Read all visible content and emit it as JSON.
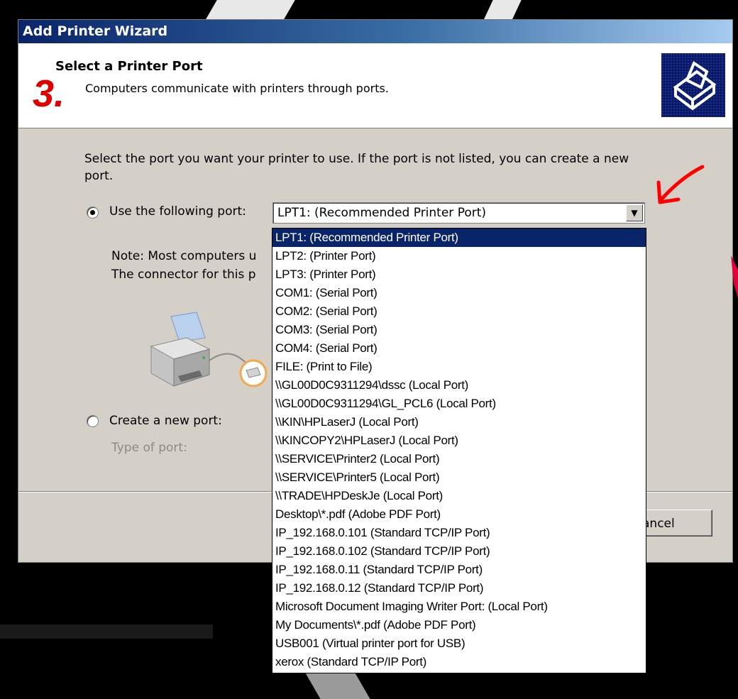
{
  "window": {
    "title": "Add Printer Wizard"
  },
  "header": {
    "step_number": "3.",
    "title": "Select a Printer Port",
    "subtitle": "Computers communicate with printers through ports.",
    "icon": "printer-wizard-icon"
  },
  "body": {
    "intro": "Select the port you want your printer to use.  If the port is not listed, you can create a new port.",
    "use_port_label": "Use the following port:",
    "use_port_checked": true,
    "combo_value": "LPT1: (Recommended Printer Port)",
    "note_line1": "Note: Most computers u",
    "note_line2": "The connector for this p",
    "create_port_label": "Create a new port:",
    "create_port_checked": false,
    "type_of_port_label": "Type of port:"
  },
  "dropdown": {
    "selected_index": 0,
    "items": [
      "LPT1: (Recommended Printer Port)",
      "LPT2: (Printer Port)",
      "LPT3: (Printer Port)",
      "COM1: (Serial Port)",
      "COM2: (Serial Port)",
      "COM3: (Serial Port)",
      "COM4: (Serial Port)",
      "FILE: (Print to File)",
      "\\\\GL00D0C9311294\\dssc (Local Port)",
      "\\\\GL00D0C9311294\\GL_PCL6 (Local Port)",
      "\\\\KIN\\HPLaserJ (Local Port)",
      "\\\\KINCOPY2\\HPLaserJ (Local Port)",
      "\\\\SERVICE\\Printer2 (Local Port)",
      "\\\\SERVICE\\Printer5 (Local Port)",
      "\\\\TRADE\\HPDeskJe (Local Port)",
      "Desktop\\*.pdf (Adobe PDF Port)",
      "IP_192.168.0.101 (Standard TCP/IP Port)",
      "IP_192.168.0.102 (Standard TCP/IP Port)",
      "IP_192.168.0.11 (Standard TCP/IP Port)",
      "IP_192.168.0.12 (Standard TCP/IP Port)",
      "Microsoft Document Imaging Writer Port: (Local Port)",
      "My Documents\\*.pdf (Adobe PDF Port)",
      "USB001 (Virtual printer port for USB)",
      "xerox (Standard TCP/IP Port)"
    ]
  },
  "footer": {
    "cancel_label": "ancel"
  },
  "colors": {
    "titlebar_start": "#0a246a",
    "titlebar_end": "#a6caf0",
    "selection": "#0a246a",
    "annotation_red": "#ff0000",
    "dialog_face": "#d4d0c8"
  }
}
